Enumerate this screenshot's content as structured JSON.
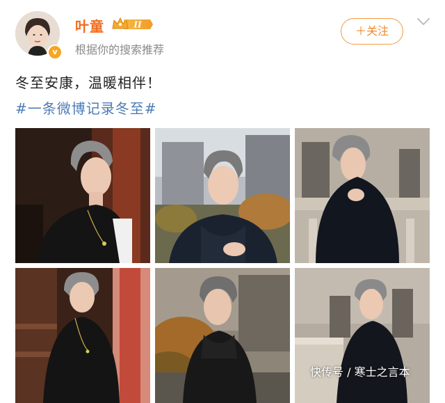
{
  "user": {
    "name": "叶童",
    "vip_level": "II",
    "subtitle": "根据你的搜索推荐",
    "verified_mark": "v"
  },
  "follow": {
    "label": "＋关注"
  },
  "post": {
    "text": "冬至安康，温暖相伴！",
    "hashtag": "#一条微博记录冬至#"
  },
  "photos": [
    {
      "name": "photo-1",
      "background": "dark warm interior"
    },
    {
      "name": "photo-2",
      "background": "city buildings"
    },
    {
      "name": "photo-3",
      "background": "stone balcony"
    },
    {
      "name": "photo-4",
      "background": "dark interior with red column"
    },
    {
      "name": "photo-5",
      "background": "outdoor autumn trees"
    },
    {
      "name": "photo-6",
      "background": "stone building terrace"
    }
  ],
  "watermark": "快传号 / 寒士之言本",
  "colors": {
    "username": "#f26b1d",
    "follow_border": "#f19a3e",
    "hashtag": "#4d7bb5",
    "subtitle": "#8a8a8a"
  },
  "icons": [
    "crown-icon",
    "chevron-down-icon",
    "verified-icon",
    "avatar"
  ]
}
